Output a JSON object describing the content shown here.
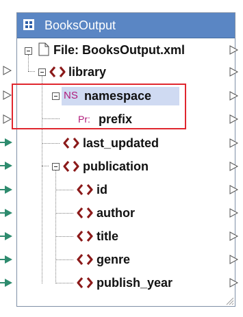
{
  "component": {
    "title": "BooksOutput",
    "file_row": {
      "prefix": "File:",
      "name": "BooksOutput.xml"
    }
  },
  "tree": {
    "library": "library",
    "namespace_badge": "NS",
    "namespace": "namespace",
    "prefix_badge": "Pr:",
    "prefix": "prefix",
    "last_updated": "last_updated",
    "publication": "publication",
    "id": "id",
    "author": "author",
    "title": "title",
    "genre": "genre",
    "publish_year": "publish_year"
  },
  "colors": {
    "title_bar": "#5a86c4",
    "element_icon": "#8b1a1a",
    "highlight_box": "#e0262e",
    "selected_bg": "#cfdaf2",
    "connected_port": "#2e8b6e"
  }
}
